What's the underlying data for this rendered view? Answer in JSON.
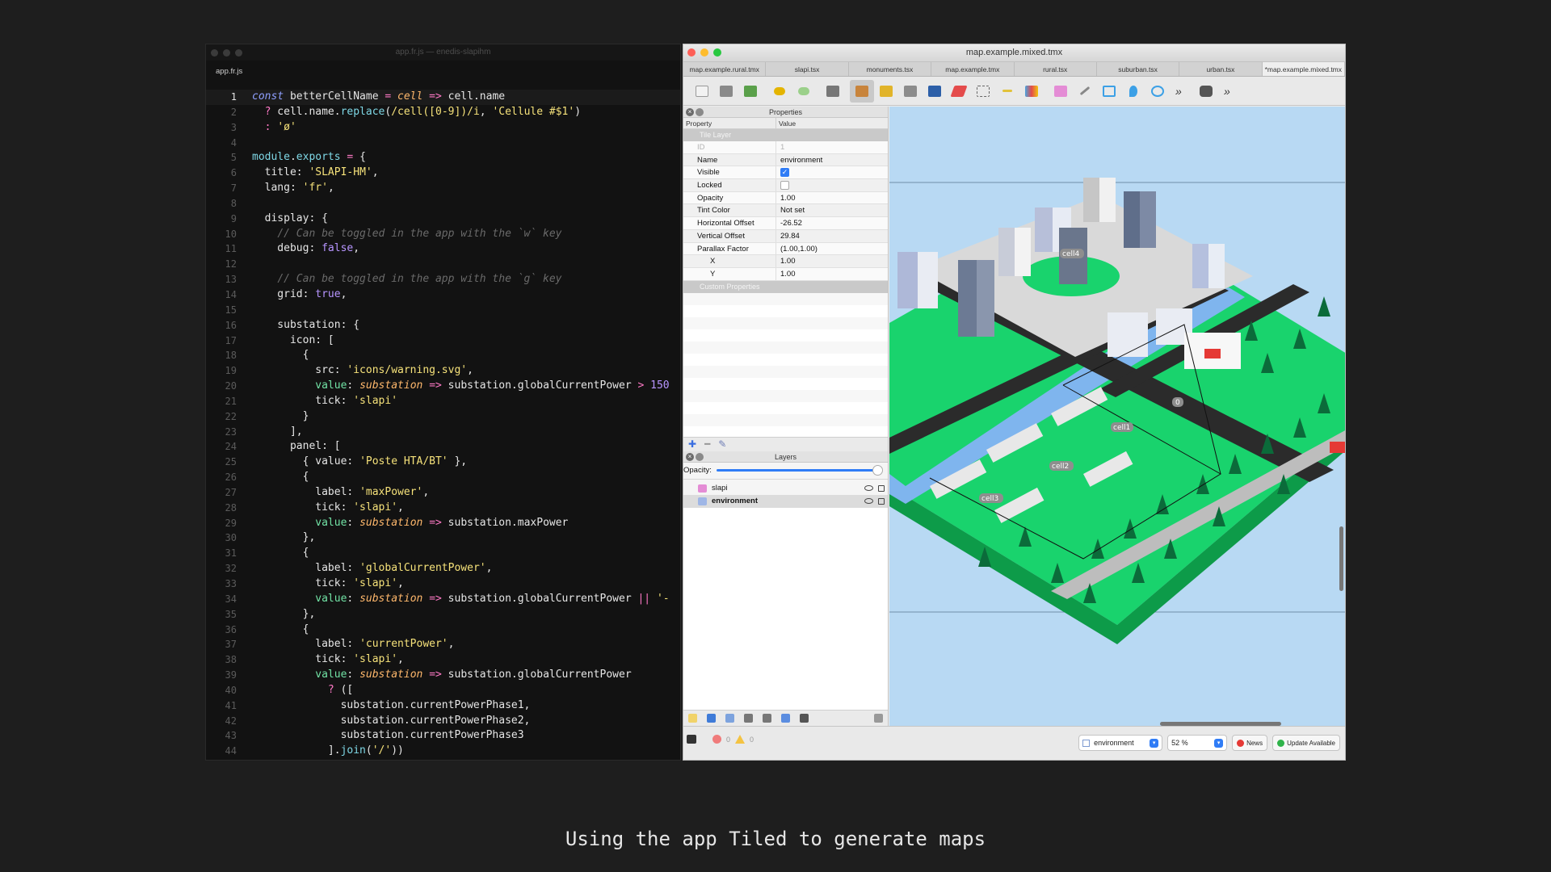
{
  "editor": {
    "title": "app.fr.js — enedis-slapihm",
    "tab": "app.fr.js",
    "lines": [
      {
        "n": "1",
        "active": true,
        "html": "<span class='k'>const</span> betterCellName <span class='o'>=</span> <span class='it'>cell</span> <span class='o'>=&gt;</span> cell.name"
      },
      {
        "n": "2",
        "html": "  <span class='o'>?</span> cell.name.<span class='fn'>replace</span>(<span class='s'>/cell([0-9])/i</span>, <span class='s'>'Cellule #$1'</span>)"
      },
      {
        "n": "3",
        "html": "  <span class='o'>:</span> <span class='s'>'ø'</span>"
      },
      {
        "n": "4",
        "html": ""
      },
      {
        "n": "5",
        "html": "<span class='fn'>module</span>.<span class='fn'>exports</span> <span class='o'>=</span> {"
      },
      {
        "n": "6",
        "html": "  title: <span class='s'>'SLAPI-HM'</span>,"
      },
      {
        "n": "7",
        "html": "  lang: <span class='s'>'fr'</span>,"
      },
      {
        "n": "8",
        "html": ""
      },
      {
        "n": "9",
        "html": "  display: {"
      },
      {
        "n": "10",
        "html": "    <span class='c'>// Can be toggled in the app with the `w` key</span>"
      },
      {
        "n": "11",
        "html": "    debug: <span class='b'>false</span>,"
      },
      {
        "n": "12",
        "html": ""
      },
      {
        "n": "13",
        "html": "    <span class='c'>// Can be toggled in the app with the `g` key</span>"
      },
      {
        "n": "14",
        "html": "    grid: <span class='b'>true</span>,"
      },
      {
        "n": "15",
        "html": ""
      },
      {
        "n": "16",
        "html": "    substation: {"
      },
      {
        "n": "17",
        "html": "      icon: ["
      },
      {
        "n": "18",
        "html": "        {"
      },
      {
        "n": "19",
        "html": "          src: <span class='s'>'icons/warning.svg'</span>,"
      },
      {
        "n": "20",
        "html": "          <span class='g'>value</span>: <span class='it'>substation</span> <span class='o'>=&gt;</span> substation.globalCurrentPower <span class='o'>&gt;</span> <span class='b'>150</span>"
      },
      {
        "n": "21",
        "html": "          tick: <span class='s'>'slapi'</span>"
      },
      {
        "n": "22",
        "html": "        }"
      },
      {
        "n": "23",
        "html": "      ],"
      },
      {
        "n": "24",
        "html": "      panel: ["
      },
      {
        "n": "25",
        "html": "        { value: <span class='s'>'Poste HTA/BT'</span> },"
      },
      {
        "n": "26",
        "html": "        {"
      },
      {
        "n": "27",
        "html": "          label: <span class='s'>'maxPower'</span>,"
      },
      {
        "n": "28",
        "html": "          tick: <span class='s'>'slapi'</span>,"
      },
      {
        "n": "29",
        "html": "          <span class='g'>value</span>: <span class='it'>substation</span> <span class='o'>=&gt;</span> substation.maxPower"
      },
      {
        "n": "30",
        "html": "        },"
      },
      {
        "n": "31",
        "html": "        {"
      },
      {
        "n": "32",
        "html": "          label: <span class='s'>'globalCurrentPower'</span>,"
      },
      {
        "n": "33",
        "html": "          tick: <span class='s'>'slapi'</span>,"
      },
      {
        "n": "34",
        "html": "          <span class='g'>value</span>: <span class='it'>substation</span> <span class='o'>=&gt;</span> substation.globalCurrentPower <span class='o'>||</span> <span class='s'>'-</span>"
      },
      {
        "n": "35",
        "html": "        },"
      },
      {
        "n": "36",
        "html": "        {"
      },
      {
        "n": "37",
        "html": "          label: <span class='s'>'currentPower'</span>,"
      },
      {
        "n": "38",
        "html": "          tick: <span class='s'>'slapi'</span>,"
      },
      {
        "n": "39",
        "html": "          <span class='g'>value</span>: <span class='it'>substation</span> <span class='o'>=&gt;</span> substation.globalCurrentPower"
      },
      {
        "n": "40",
        "html": "            <span class='o'>?</span> (["
      },
      {
        "n": "41",
        "html": "              substation.currentPowerPhase1,"
      },
      {
        "n": "42",
        "html": "              substation.currentPowerPhase2,"
      },
      {
        "n": "43",
        "html": "              substation.currentPowerPhase3"
      },
      {
        "n": "44",
        "html": "            ].<span class='fn'>join</span>(<span class='s'>'/'</span>))"
      }
    ]
  },
  "tiled": {
    "title": "map.example.mixed.tmx",
    "tabs": [
      {
        "label": "map.example.rural.tmx",
        "active": false
      },
      {
        "label": "slapi.tsx",
        "active": false
      },
      {
        "label": "monuments.tsx",
        "active": false
      },
      {
        "label": "map.example.tmx",
        "active": false
      },
      {
        "label": "rural.tsx",
        "active": false
      },
      {
        "label": "suburban.tsx",
        "active": false
      },
      {
        "label": "urban.tsx",
        "active": false
      },
      {
        "label": "*map.example.mixed.tmx",
        "active": true
      }
    ],
    "properties": {
      "panel_title": "Properties",
      "col_property": "Property",
      "col_value": "Value",
      "group_tile_layer": "Tile Layer",
      "group_custom": "Custom Properties",
      "rows": [
        {
          "key": "ID",
          "value": "1",
          "dim": true
        },
        {
          "key": "Name",
          "value": "environment"
        },
        {
          "key": "Visible",
          "value": "",
          "checkbox": "on"
        },
        {
          "key": "Locked",
          "value": "",
          "checkbox": "off"
        },
        {
          "key": "Opacity",
          "value": "1.00"
        },
        {
          "key": "Tint Color",
          "value": "Not set"
        },
        {
          "key": "Horizontal Offset",
          "value": "-26.52"
        },
        {
          "key": "Vertical Offset",
          "value": "29.84"
        },
        {
          "key": "Parallax Factor",
          "value": "(1.00,1.00)"
        },
        {
          "key": "X",
          "value": "1.00",
          "indent": true
        },
        {
          "key": "Y",
          "value": "1.00",
          "indent": true
        }
      ]
    },
    "layers": {
      "panel_title": "Layers",
      "opacity_label": "Opacity:",
      "opacity_value": 1.0,
      "items": [
        {
          "name": "slapi",
          "selected": false
        },
        {
          "name": "environment",
          "selected": true
        }
      ]
    },
    "map_labels": [
      "cell4",
      "cell1",
      "cell2",
      "cell3",
      "0"
    ],
    "status": {
      "errors": "0",
      "warnings": "0",
      "layer": "environment",
      "zoom": "52 %",
      "news": "News",
      "update": "Update Available"
    }
  },
  "caption": "Using the app Tiled to generate maps"
}
